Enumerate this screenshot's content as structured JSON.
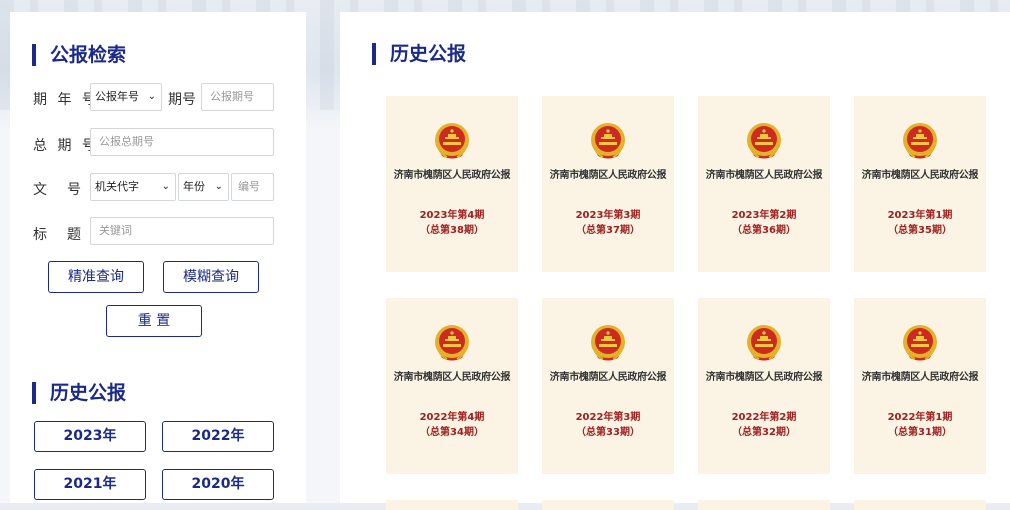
{
  "search": {
    "title": "公报检索",
    "period_label": "期 年 号",
    "year_select": "公报年号",
    "issue_label": "期号",
    "issue_placeholder": "公报期号",
    "total_label": "总 期 号",
    "total_placeholder": "公报总期号",
    "doc_label": "文　号",
    "org_select": "机关代字",
    "doc_year_select": "年份",
    "doc_no_placeholder": "编号",
    "title_label": "标　题",
    "keyword_placeholder": "关键词",
    "exact_btn": "精准查询",
    "fuzzy_btn": "模糊查询",
    "reset_btn": "重 置"
  },
  "history_left": {
    "title": "历史公报",
    "years": [
      "2023年",
      "2022年",
      "2021年",
      "2020年"
    ]
  },
  "history_main": {
    "title": "历史公报",
    "cards": [
      {
        "name": "济南市槐荫区人民政府公报",
        "issue": "2023年第4期",
        "total": "（总第38期）"
      },
      {
        "name": "济南市槐荫区人民政府公报",
        "issue": "2023年第3期",
        "total": "（总第37期）"
      },
      {
        "name": "济南市槐荫区人民政府公报",
        "issue": "2023年第2期",
        "total": "（总第36期）"
      },
      {
        "name": "济南市槐荫区人民政府公报",
        "issue": "2023年第1期",
        "total": "（总第35期）"
      },
      {
        "name": "济南市槐荫区人民政府公报",
        "issue": "2022年第4期",
        "total": "（总第34期）"
      },
      {
        "name": "济南市槐荫区人民政府公报",
        "issue": "2022年第3期",
        "total": "（总第33期）"
      },
      {
        "name": "济南市槐荫区人民政府公报",
        "issue": "2022年第2期",
        "total": "（总第32期）"
      },
      {
        "name": "济南市槐荫区人民政府公报",
        "issue": "2022年第1期",
        "total": "（总第31期）"
      }
    ]
  },
  "colors": {
    "accent": "#1b2a8a",
    "card_bg": "#fbf4e4",
    "issue_red": "#a02020"
  }
}
